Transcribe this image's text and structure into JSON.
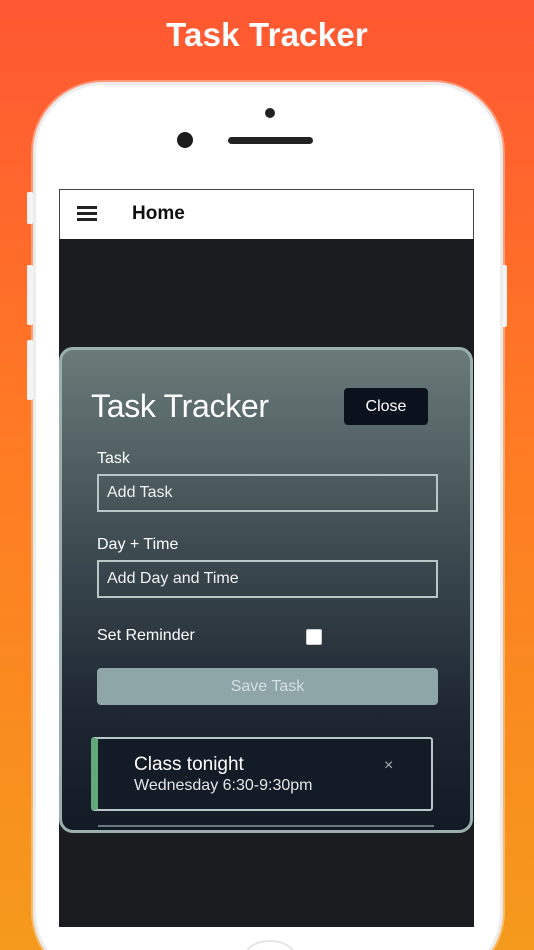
{
  "promo": {
    "title": "Task Tracker"
  },
  "appbar": {
    "menu_icon": "hamburger-menu-icon",
    "title": "Home"
  },
  "modal": {
    "title": "Task Tracker",
    "close_label": "Close",
    "task_label": "Task",
    "task_placeholder": "Add Task",
    "daytime_label": "Day + Time",
    "daytime_placeholder": "Add Day and Time",
    "reminder_label": "Set Reminder",
    "reminder_checked": false,
    "save_label": "Save Task"
  },
  "tasks": [
    {
      "name": "Class tonight",
      "time": "Wednesday 6:30-9:30pm",
      "delete_glyph": "×",
      "reminder": true
    }
  ],
  "colors": {
    "background_top": "#ff5733",
    "background_bottom": "#f59a1c",
    "reminder_accent": "#62a87b",
    "close_button": "#0b111d",
    "save_button": "#8fa6a8"
  }
}
